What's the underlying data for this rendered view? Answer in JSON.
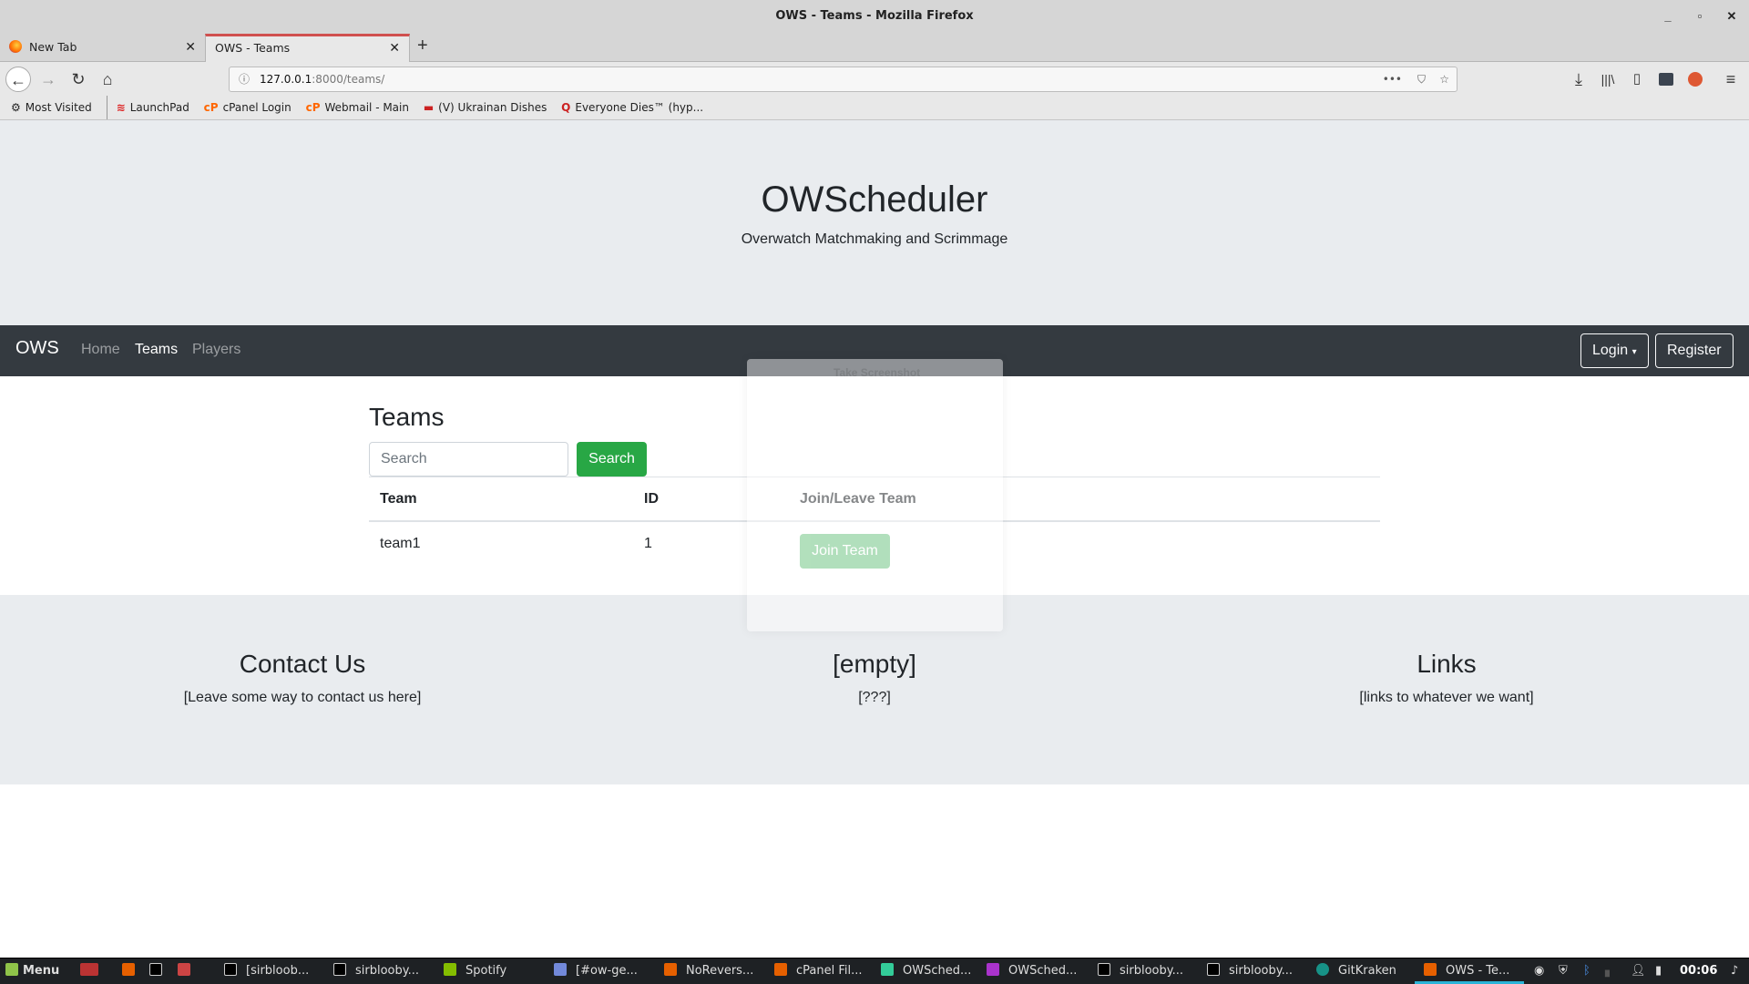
{
  "window": {
    "title": "OWS - Teams - Mozilla Firefox"
  },
  "tabs": [
    {
      "label": "New Tab"
    },
    {
      "label": "OWS - Teams"
    }
  ],
  "url": {
    "host": "127.0.0.1",
    "rest": ":8000/teams/"
  },
  "bookmarks": [
    "Most Visited",
    "LaunchPad",
    "cPanel Login",
    "Webmail - Main",
    "(V) Ukrainan Dishes",
    "Everyone Dies™ (hyp..."
  ],
  "site": {
    "title": "OWScheduler",
    "subtitle": "Overwatch Matchmaking and Scrimmage",
    "brand": "OWS",
    "nav": [
      "Home",
      "Teams",
      "Players"
    ],
    "active_nav": "Teams",
    "login": "Login",
    "register": "Register"
  },
  "teams": {
    "heading": "Teams",
    "search_placeholder": "Search",
    "search_button": "Search",
    "columns": [
      "Team",
      "ID",
      "Join/Leave Team"
    ],
    "rows": [
      {
        "team": "team1",
        "id": "1",
        "action": "Join Team"
      }
    ]
  },
  "footer": [
    {
      "title": "Contact Us",
      "text": "[Leave some way to contact us here]"
    },
    {
      "title": "[empty]",
      "text": "[???]"
    },
    {
      "title": "Links",
      "text": "[links to whatever we want]"
    }
  ],
  "overlay": {
    "title": "Take Screenshot"
  },
  "taskbar": {
    "menu": "Menu",
    "items": [
      "[sirbloob...",
      "sirblooby...",
      "Spotify",
      "[#ow-ge...",
      "NoRevers...",
      "cPanel Fil...",
      "OWSched...",
      "OWSched...",
      "sirblooby...",
      "sirblooby...",
      "GitKraken",
      "OWS - Te..."
    ],
    "clock": "00:06"
  },
  "colors": {
    "primary_green": "#28a745",
    "navbar": "#343a40",
    "jumbotron": "#e9ecef",
    "tab_accent": "#d0504f"
  }
}
